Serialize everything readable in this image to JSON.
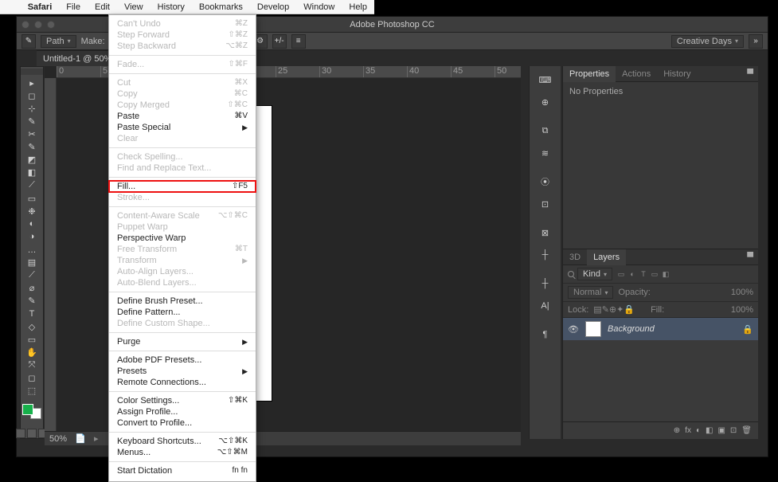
{
  "mac_menu": {
    "items": [
      "Safari",
      "File",
      "Edit",
      "View",
      "History",
      "Bookmarks",
      "Develop",
      "Window",
      "Help"
    ]
  },
  "ps": {
    "title": "Adobe Photoshop CC",
    "workspace": "Creative Days",
    "options_left": "Path",
    "options_make": "Make:",
    "doc_tab": "Untitled-1 @ 50%...",
    "tab_close": "×",
    "status_zoom": "50%"
  },
  "tool_glyphs": [
    "▸",
    "◻",
    "⊹",
    "✎",
    "✂",
    "✎",
    "◩",
    "◧",
    "⟋",
    "▭",
    "❉",
    "◐",
    "◑",
    "…",
    "▤",
    "⟋",
    "⌀",
    "✎",
    "T",
    "◇",
    "▭",
    "✋",
    "⤧",
    "◻",
    "⬚"
  ],
  "dock_mini_glyphs": [
    "⌨",
    "⊕",
    "⧉",
    "≋",
    "⦿",
    "⊡",
    "⊠",
    "┼",
    "┼",
    "A|",
    "¶"
  ],
  "properties": {
    "tabs": [
      "Properties",
      "Actions",
      "History"
    ],
    "body": "No Properties"
  },
  "layers": {
    "tabs": [
      "3D",
      "Layers"
    ],
    "kind_label": "Kind",
    "filter_icons": [
      "▭",
      "◐",
      "T",
      "▭",
      "◧"
    ],
    "blend_mode": "Normal",
    "opacity_label": "Opacity:",
    "opacity_value": "100%",
    "lock_label": "Lock:",
    "lock_icons": [
      "▤",
      "✎",
      "⊕",
      "✦",
      "🔒"
    ],
    "fill_label": "Fill:",
    "fill_value": "100%",
    "layer_name": "Background",
    "footer_icons": [
      "⊕",
      "fx",
      "◐",
      "◧",
      "▣",
      "⊡",
      "🗑"
    ]
  },
  "edit_menu": {
    "groups": [
      [
        {
          "label": "Can't Undo",
          "shortcut": "⌘Z",
          "enabled": false
        },
        {
          "label": "Step Forward",
          "shortcut": "⇧⌘Z",
          "enabled": false
        },
        {
          "label": "Step Backward",
          "shortcut": "⌥⌘Z",
          "enabled": false
        }
      ],
      [
        {
          "label": "Fade...",
          "shortcut": "⇧⌘F",
          "enabled": false
        }
      ],
      [
        {
          "label": "Cut",
          "shortcut": "⌘X",
          "enabled": false
        },
        {
          "label": "Copy",
          "shortcut": "⌘C",
          "enabled": false
        },
        {
          "label": "Copy Merged",
          "shortcut": "⇧⌘C",
          "enabled": false
        },
        {
          "label": "Paste",
          "shortcut": "⌘V",
          "enabled": true
        },
        {
          "label": "Paste Special",
          "submenu": true,
          "enabled": true
        },
        {
          "label": "Clear",
          "enabled": false
        }
      ],
      [
        {
          "label": "Check Spelling...",
          "enabled": false
        },
        {
          "label": "Find and Replace Text...",
          "enabled": false
        }
      ],
      [
        {
          "label": "Fill...",
          "shortcut": "⇧F5",
          "enabled": true,
          "highlight": true
        },
        {
          "label": "Stroke...",
          "enabled": false
        }
      ],
      [
        {
          "label": "Content-Aware Scale",
          "shortcut": "⌥⇧⌘C",
          "enabled": false
        },
        {
          "label": "Puppet Warp",
          "enabled": false
        },
        {
          "label": "Perspective Warp",
          "enabled": true
        },
        {
          "label": "Free Transform",
          "shortcut": "⌘T",
          "enabled": false
        },
        {
          "label": "Transform",
          "submenu": true,
          "enabled": false
        },
        {
          "label": "Auto-Align Layers...",
          "enabled": false
        },
        {
          "label": "Auto-Blend Layers...",
          "enabled": false
        }
      ],
      [
        {
          "label": "Define Brush Preset...",
          "enabled": true
        },
        {
          "label": "Define Pattern...",
          "enabled": true
        },
        {
          "label": "Define Custom Shape...",
          "enabled": false
        }
      ],
      [
        {
          "label": "Purge",
          "submenu": true,
          "enabled": true
        }
      ],
      [
        {
          "label": "Adobe PDF Presets...",
          "enabled": true
        },
        {
          "label": "Presets",
          "submenu": true,
          "enabled": true
        },
        {
          "label": "Remote Connections...",
          "enabled": true
        }
      ],
      [
        {
          "label": "Color Settings...",
          "shortcut": "⇧⌘K",
          "enabled": true
        },
        {
          "label": "Assign Profile...",
          "enabled": true
        },
        {
          "label": "Convert to Profile...",
          "enabled": true
        }
      ],
      [
        {
          "label": "Keyboard Shortcuts...",
          "shortcut": "⌥⇧⌘K",
          "enabled": true
        },
        {
          "label": "Menus...",
          "shortcut": "⌥⇧⌘M",
          "enabled": true
        }
      ],
      [
        {
          "label": "Start Dictation",
          "shortcut": "fn fn",
          "enabled": true
        }
      ]
    ]
  }
}
